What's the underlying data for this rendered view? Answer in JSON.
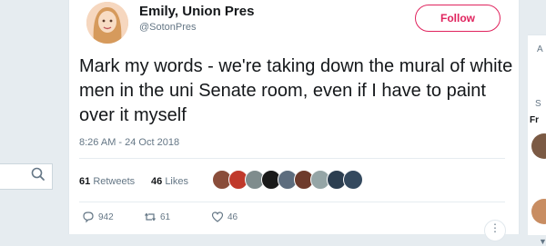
{
  "tweet": {
    "display_name": "Emily, Union Pres",
    "username": "@SotonPres",
    "follow_label": "Follow",
    "text": "Mark my words - we're taking down the mural of white men in the uni Senate room, even if I have to paint over it myself",
    "timestamp": "8:26 AM - 24 Oct 2018",
    "retweets_count": "61",
    "retweets_label": "Retweets",
    "likes_count": "46",
    "likes_label": "Likes",
    "reply_count": "942",
    "retweet_action_count": "61",
    "like_action_count": "46"
  },
  "right_sidebar": {
    "partial_heading_a": "A",
    "partial_heading_s": "S",
    "partial_name": "Fr"
  },
  "colors": {
    "accent": "#e0245e",
    "muted": "#657786",
    "background": "#e6ecf0"
  }
}
